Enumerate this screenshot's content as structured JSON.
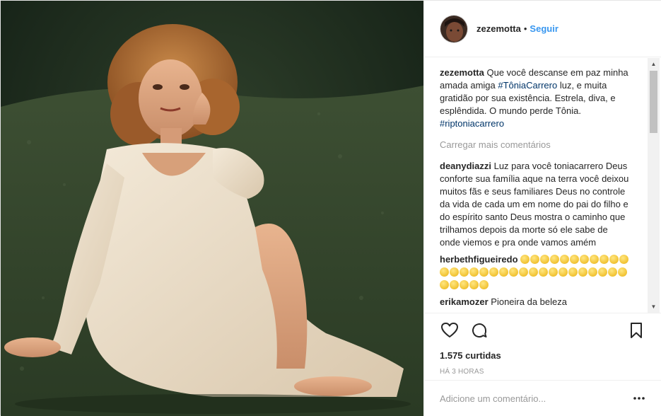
{
  "photo": {
    "description_icon": "photo"
  },
  "header": {
    "username": "zezemotta",
    "separator": "•",
    "follow_label": "Seguir"
  },
  "caption": {
    "username": "zezemotta",
    "text_before": "Que você descanse em paz minha amada amiga ",
    "hashtag1": "#TôniaCarrero",
    "text_after": " luz, e muita gratidão por sua existência. Estrela, diva, e esplêndida. O mundo perde Tônia. ",
    "hashtag2": "#riptoniacarrero"
  },
  "load_more": "Carregar mais comentários",
  "comments": [
    {
      "username": "deanydiazzi",
      "text": "Luz para você toniacarrero Deus conforte sua família aque na terra você deixou muitos fãs e seus familiares Deus no controle da vida de cada um em nome do pai do filho e do espírito santo Deus mostra o caminho que trilhamos depois da morte só ele sabe de onde viemos e pra onde vamos amém"
    },
    {
      "username": "herbethfigueiredo",
      "emoji_count": 35
    },
    {
      "username": "erikamozer",
      "text": "Pioneira da beleza"
    }
  ],
  "likes": "1.575 curtidas",
  "time": "HÁ 3 HORAS",
  "add_comment_placeholder": "Adicione um comentário...",
  "icons": {
    "like": "heart-icon",
    "comment": "comment-icon",
    "save": "bookmark-icon",
    "more": "more-options-icon"
  },
  "colors": {
    "link": "#3897f0",
    "hashtag": "#003569",
    "muted": "#999999"
  }
}
